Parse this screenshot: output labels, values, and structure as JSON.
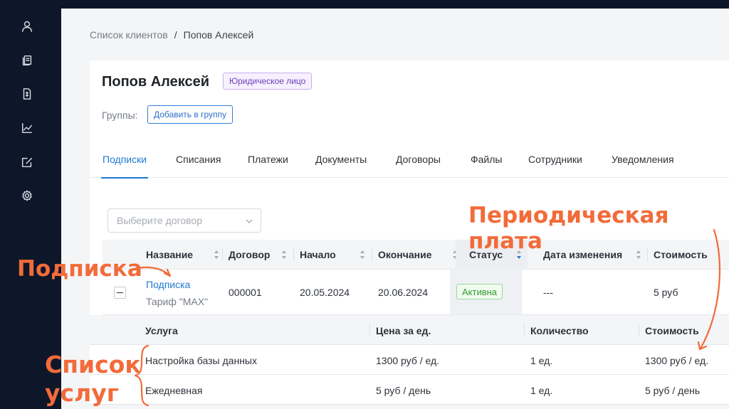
{
  "sidebar": {
    "icons": [
      "user-icon",
      "documents-icon",
      "invoice-icon",
      "chart-icon",
      "edit-icon",
      "gear-icon"
    ]
  },
  "breadcrumb": {
    "root": "Список клиентов",
    "separator": "/",
    "current": "Попов Алексей"
  },
  "client": {
    "name": "Попов Алексей",
    "type_badge": "Юридическое лицо",
    "groups_label": "Группы:",
    "add_group_button": "Добавить в группу"
  },
  "tabs": [
    {
      "label": "Подписки",
      "active": true
    },
    {
      "label": "Списания"
    },
    {
      "label": "Платежи"
    },
    {
      "label": "Документы"
    },
    {
      "label": "Договоры"
    },
    {
      "label": "Файлы"
    },
    {
      "label": "Сотрудники"
    },
    {
      "label": "Уведомления"
    }
  ],
  "contract_select": {
    "placeholder": "Выберите договор"
  },
  "table": {
    "columns": [
      "Название",
      "Договор",
      "Начало",
      "Окончание",
      "Статус",
      "Дата изменения",
      "Стоимость"
    ],
    "row": {
      "name": "Подписка",
      "tariff": "Тариф \"MAX\"",
      "contract": "000001",
      "start": "20.05.2024",
      "end": "20.06.2024",
      "status": "Активна",
      "changed": "---",
      "cost": "5 руб"
    }
  },
  "services": {
    "columns": [
      "Услуга",
      "Цена за ед.",
      "Количество",
      "Стоимость"
    ],
    "rows": [
      {
        "service": "Настройка базы данных",
        "price": "1300 руб / ед.",
        "qty": "1 ед.",
        "cost": "1300 руб / ед."
      },
      {
        "service": "Ежедневная",
        "price": "5 руб / день",
        "qty": "1 ед.",
        "cost": "5 руб / день"
      }
    ]
  },
  "annotations": {
    "subscription": "Подписка",
    "periodic_fee": "Периодическая плата",
    "service_list_line1": "Список",
    "service_list_line2": "услуг",
    "color": "#f26b3a"
  },
  "colors": {
    "sidebar": "#0e1729",
    "accent": "#1f78d1",
    "status_active": "#2f9b2f",
    "legal_badge": "#6b3fb8"
  }
}
